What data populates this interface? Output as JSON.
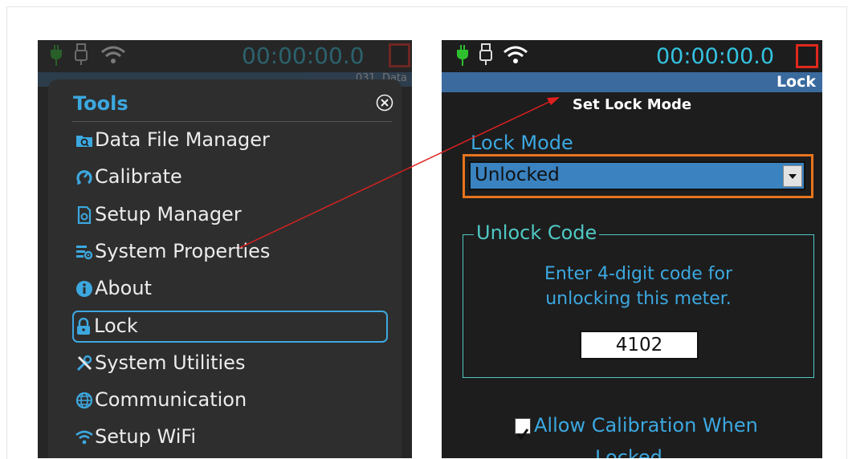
{
  "left_screen": {
    "status": {
      "timer": "00:00:00.0",
      "bar_text": "031. Data"
    },
    "menu": {
      "title": "Tools",
      "items": [
        {
          "label": "Data File Manager",
          "icon": "folder-search-icon"
        },
        {
          "label": "Calibrate",
          "icon": "calibrate-icon"
        },
        {
          "label": "Setup Manager",
          "icon": "setup-manager-icon"
        },
        {
          "label": "System Properties",
          "icon": "system-properties-icon"
        },
        {
          "label": "About",
          "icon": "info-icon"
        },
        {
          "label": "Lock",
          "icon": "lock-icon",
          "selected": true
        },
        {
          "label": "System Utilities",
          "icon": "tools-icon"
        },
        {
          "label": "Communication",
          "icon": "globe-icon"
        },
        {
          "label": "Setup WiFi",
          "icon": "wifi-icon"
        }
      ]
    }
  },
  "right_screen": {
    "status": {
      "timer": "00:00:00.0"
    },
    "title_bar": "Lock",
    "section_heading": "Set Lock Mode",
    "lock_mode": {
      "label": "Lock Mode",
      "selected": "Unlocked"
    },
    "unlock_code": {
      "title": "Unlock Code",
      "instructions_line1": "Enter 4-digit code for",
      "instructions_line2": "unlocking this meter.",
      "code": "4102"
    },
    "allow_calibration": {
      "line1": "Allow Calibration When",
      "line2": "Locked",
      "checked": true
    }
  },
  "colors": {
    "accent_blue": "#3ca8e0",
    "focus_orange": "#e8741e",
    "record_red": "#e0281e",
    "title_bar_blue": "#3a6a9e",
    "annotation_arrow": "#e02020"
  }
}
